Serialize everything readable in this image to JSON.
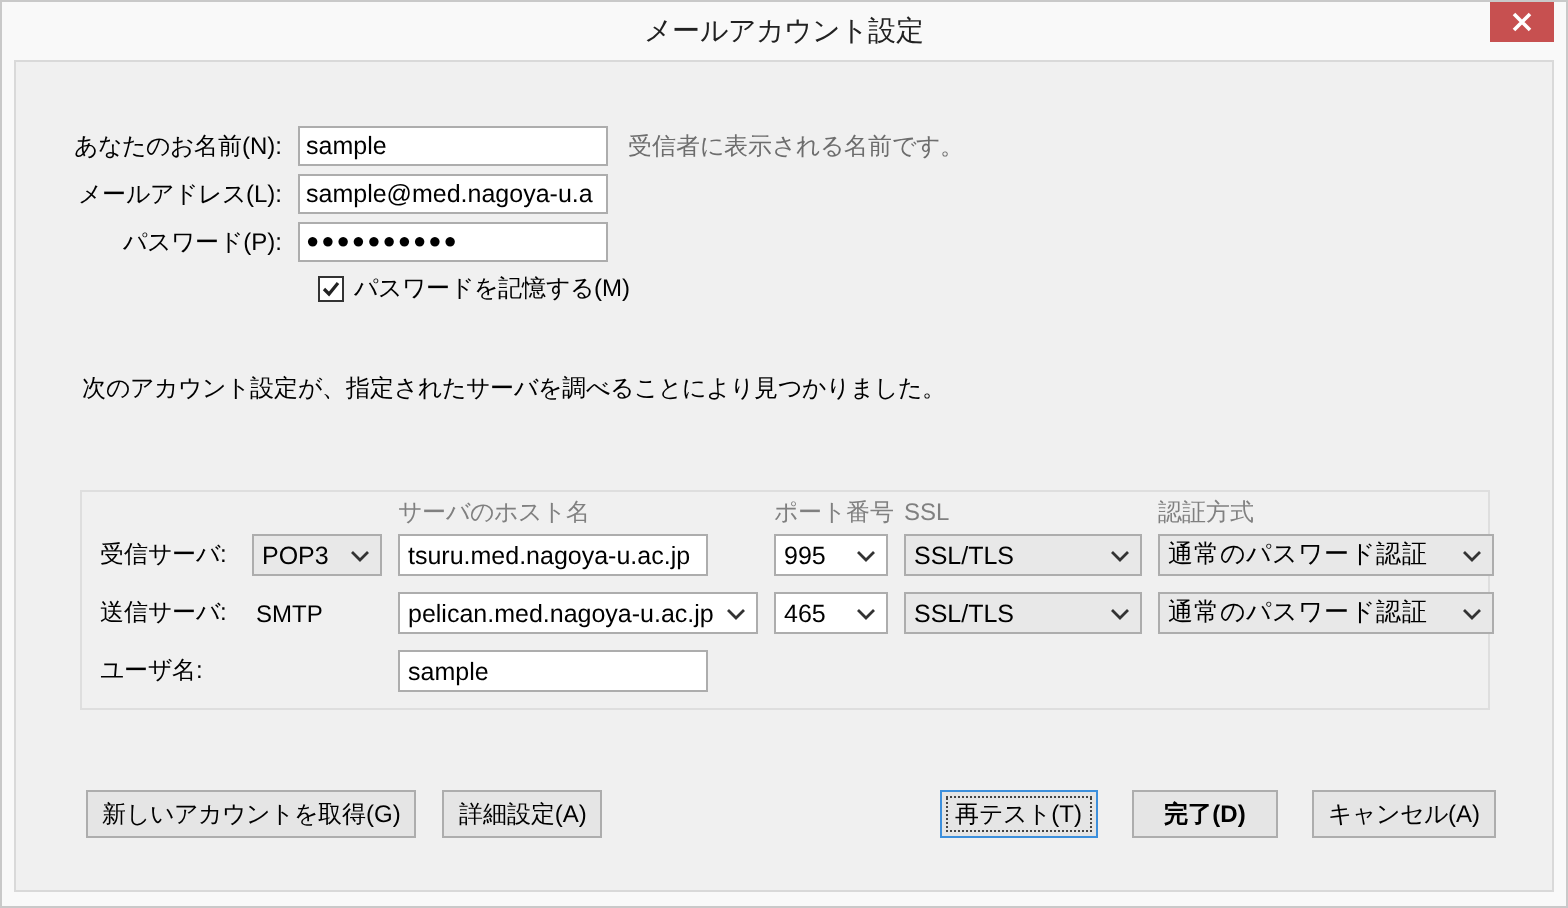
{
  "window": {
    "title": "メールアカウント設定"
  },
  "account": {
    "fields": [
      {
        "label": "あなたのお名前(N):",
        "value": "sample",
        "kind": "text",
        "hint": "受信者に表示される名前です。"
      },
      {
        "label": "メールアドレス(L):",
        "value": "sample@med.nagoya-u.a",
        "kind": "text"
      },
      {
        "label": "パスワード(P):",
        "value": "●●●●●●●●●●",
        "kind": "password"
      }
    ],
    "remember": {
      "label": "パスワードを記憶する(M)",
      "checked": true
    }
  },
  "message": "次のアカウント設定が、指定されたサーバを調べることにより見つかりました。",
  "servers": {
    "columns": [
      "サーバのホスト名",
      "ポート番号",
      "SSL",
      "認証方式"
    ],
    "rows": [
      {
        "label": "受信サーバ:",
        "protocol": {
          "kind": "select",
          "value": "POP3"
        },
        "host": {
          "kind": "input",
          "value": "tsuru.med.nagoya-u.ac.jp"
        },
        "port": {
          "kind": "combo",
          "value": "995"
        },
        "ssl": {
          "kind": "select",
          "value": "SSL/TLS"
        },
        "auth": {
          "kind": "select",
          "value": "通常のパスワード認証"
        }
      },
      {
        "label": "送信サーバ:",
        "protocol": {
          "kind": "text",
          "value": "SMTP"
        },
        "host": {
          "kind": "combo",
          "value": "pelican.med.nagoya-u.ac.jp"
        },
        "port": {
          "kind": "combo",
          "value": "465"
        },
        "ssl": {
          "kind": "select",
          "value": "SSL/TLS"
        },
        "auth": {
          "kind": "select",
          "value": "通常のパスワード認証"
        }
      },
      {
        "label": "ユーザ名:",
        "host": {
          "kind": "input",
          "value": "sample"
        }
      }
    ]
  },
  "buttons_left": [
    {
      "label": "新しいアカウントを取得(G)",
      "focused": false,
      "default": false
    },
    {
      "label": "詳細設定(A)",
      "focused": false,
      "default": false
    }
  ],
  "buttons_right": [
    {
      "label": "再テスト(T)",
      "focused": true,
      "default": false
    },
    {
      "label": "完了(D)",
      "focused": false,
      "default": true
    },
    {
      "label": "キャンセル(A)",
      "focused": false,
      "default": false
    }
  ]
}
